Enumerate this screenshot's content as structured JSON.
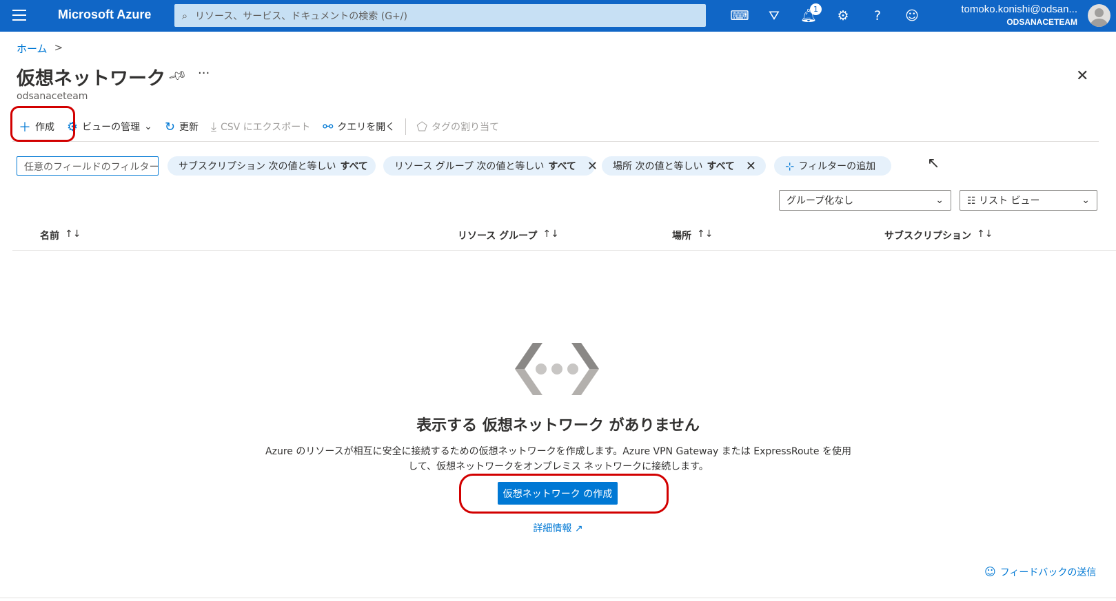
{
  "topbar": {
    "brand": "Microsoft Azure",
    "search_placeholder": "リソース、サービス、ドキュメントの検索 (G+/)",
    "notification_count": "1",
    "user_email": "tomoko.konishi@odsan...",
    "user_tenant": "ODSANACETEAM",
    "icons": [
      "cloud-shell-icon",
      "directory-filter-icon",
      "bell-icon",
      "gear-icon",
      "help-icon",
      "feedback-icon"
    ]
  },
  "breadcrumb": {
    "home": "ホーム",
    "separator": ">"
  },
  "page": {
    "title": "仮想ネットワーク",
    "subtitle": "odsanaceteam"
  },
  "toolbar": {
    "create": "作成",
    "manage_view": "ビューの管理",
    "refresh": "更新",
    "export_csv": "CSV にエクスポート",
    "open_query": "クエリを開く",
    "assign_tags": "タグの割り当て"
  },
  "filters": {
    "input_placeholder": "任意のフィールドのフィルター...",
    "subscription": {
      "label": "サブスクリプション 次の値と等しい",
      "value": "すべて"
    },
    "resource_group": {
      "label": "リソース グループ 次の値と等しい",
      "value": "すべて"
    },
    "location": {
      "label": "場所 次の値と等しい",
      "value": "すべて"
    },
    "add_filter": "フィルターの追加"
  },
  "dropdowns": {
    "grouping": "グループ化なし",
    "view": "☷ リスト ビュー"
  },
  "table": {
    "columns": [
      "名前",
      "リソース グループ",
      "場所",
      "サブスクリプション"
    ]
  },
  "empty_state": {
    "title": "表示する 仮想ネットワーク がありません",
    "description": "Azure のリソースが相互に安全に接続するための仮想ネットワークを作成します。Azure VPN Gateway または ExpressRoute を使用して、仮想ネットワークをオンプレミス ネットワークに接続します。",
    "cta": "仮想ネットワーク の作成",
    "learn_more": "詳細情報"
  },
  "footer": {
    "feedback": "フィードバックの送信"
  },
  "colors": {
    "header": "#1066c6",
    "accent": "#0078d4",
    "highlight": "#d20000",
    "pill_bg": "#e6f1fb"
  }
}
